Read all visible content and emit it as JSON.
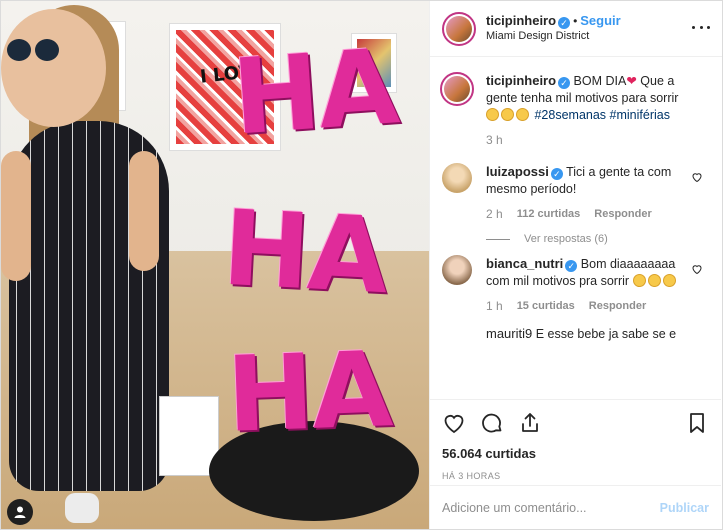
{
  "post": {
    "username": "ticipinheiro",
    "follow_label": "Seguir",
    "location": "Miami Design District",
    "image_alt": "Grávida rindo ao lado da escultura HA HA HA rosa"
  },
  "caption": {
    "username": "ticipinheiro",
    "text_before": "BOM DIA",
    "text_after": " Que a gente tenha mil motivos para sorrir",
    "hashtags": "#28semanas #miniférias",
    "time": "3 h"
  },
  "comments": [
    {
      "username": "luizapossi",
      "text": "Tici a gente ta com mesmo período!",
      "time": "2 h",
      "likes": "112 curtidas",
      "reply_label": "Responder",
      "view_replies": "Ver respostas (6)"
    },
    {
      "username": "bianca_nutri",
      "text": "Bom diaaaaaaaa com mil motivos pra sorrir",
      "time": "1 h",
      "likes": "15 curtidas",
      "reply_label": "Responder"
    },
    {
      "username": "mauriti9",
      "text": "E esse bebe ja sabe se e"
    }
  ],
  "likes_label": "56.064 curtidas",
  "timestamp": "HÁ 3 HORAS",
  "add_comment": {
    "placeholder": "Adicione um comentário...",
    "publish_label": "Publicar"
  },
  "artwork_text": "I LOV",
  "sculpture_text": [
    "HA",
    "HA",
    "HA"
  ],
  "icons": [
    "heart-icon",
    "comment-icon",
    "share-icon",
    "bookmark-icon",
    "more-icon",
    "user-tag-icon"
  ],
  "colors": {
    "accent": "#3897f0",
    "heart": "#e0245e",
    "sculpture": "#e02b9a"
  }
}
